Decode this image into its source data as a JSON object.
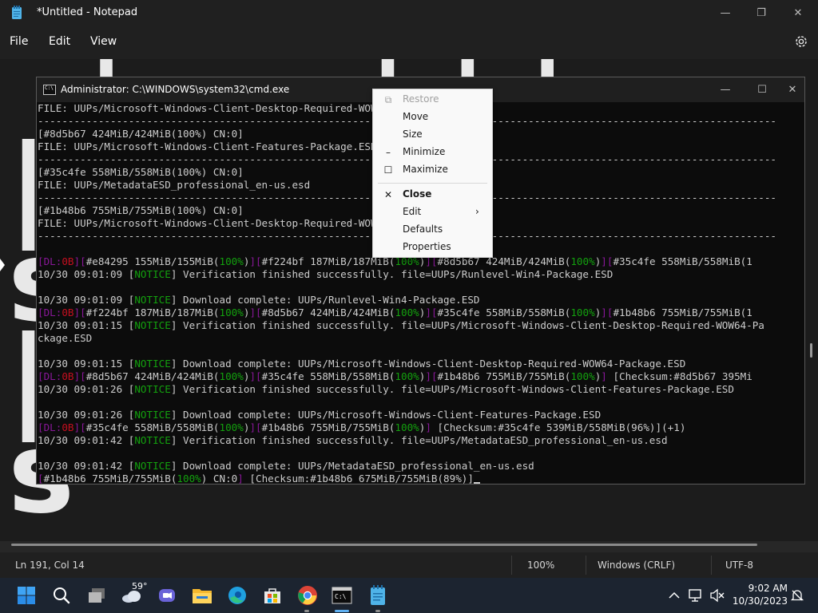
{
  "notepad": {
    "title": "*Untitled - Notepad",
    "menu": {
      "file": "File",
      "edit": "Edit",
      "view": "View"
    },
    "window_controls": {
      "minimize": "—",
      "maximize": "❐",
      "close": "✕"
    },
    "background_text": "  | ,  , | | |\n|\ns\n|\ns\nc",
    "status": {
      "position": "Ln 191, Col 14",
      "zoom": "100%",
      "line_ending": "Windows (CRLF)",
      "encoding": "UTF-8"
    }
  },
  "cmd": {
    "title": "Administrator: C:\\WINDOWS\\system32\\cmd.exe",
    "window_controls": {
      "minimize": "—",
      "maximize": "☐",
      "close": "✕"
    },
    "lines": [
      [
        {
          "t": "FILE: UUPs/Microsoft-Windows-Client-Desktop-Required-WOW64-Package.ESD"
        }
      ],
      [
        {
          "t": "--------------------------------------------------------------------------------------------------------------------------"
        }
      ],
      [
        {
          "t": "[#8d5b67 424MiB/424MiB(100%) CN:0]"
        }
      ],
      [
        {
          "t": "FILE: UUPs/Microsoft-Windows-Client-Features-Package.ESD"
        }
      ],
      [
        {
          "t": "--------------------------------------------------------------------------------------------------------------------------"
        }
      ],
      [
        {
          "t": "[#35c4fe 558MiB/558MiB(100%) CN:0]"
        }
      ],
      [
        {
          "t": "FILE: UUPs/MetadataESD_professional_en-us.esd"
        }
      ],
      [
        {
          "t": "--------------------------------------------------------------------------------------------------------------------------"
        }
      ],
      [
        {
          "t": "[#1b48b6 755MiB/755MiB(100%) CN:0]"
        }
      ],
      [
        {
          "t": "FILE: UUPs/Microsoft-Windows-Client-Desktop-Required-WOW64-Package.ESD"
        }
      ],
      [
        {
          "t": "--------------------------------------------------------------------------------------------------------------------------"
        }
      ],
      [
        {
          "t": ""
        }
      ],
      [
        {
          "t": "[",
          "c": "m"
        },
        {
          "t": "DL:",
          "c": "m"
        },
        {
          "t": "0B",
          "c": "r"
        },
        {
          "t": "][",
          "c": "m"
        },
        {
          "t": "#e84295 155MiB/155MiB("
        },
        {
          "t": "100%",
          "c": "g"
        },
        {
          "t": ")"
        },
        {
          "t": "][",
          "c": "m"
        },
        {
          "t": "#f224bf 187MiB/187MiB("
        },
        {
          "t": "100%",
          "c": "g"
        },
        {
          "t": ")"
        },
        {
          "t": "][",
          "c": "m"
        },
        {
          "t": "#8d5b67 424MiB/424MiB("
        },
        {
          "t": "100%",
          "c": "g"
        },
        {
          "t": ")"
        },
        {
          "t": "][",
          "c": "m"
        },
        {
          "t": "#35c4fe 558MiB/558MiB(1"
        }
      ],
      [
        {
          "t": "10/30 09:01:09 ["
        },
        {
          "t": "NOTICE",
          "c": "g"
        },
        {
          "t": "] Verification finished successfully. file=UUPs/Runlevel-Win4-Package.ESD"
        }
      ],
      [
        {
          "t": ""
        }
      ],
      [
        {
          "t": "10/30 09:01:09 ["
        },
        {
          "t": "NOTICE",
          "c": "g"
        },
        {
          "t": "] Download complete: UUPs/Runlevel-Win4-Package.ESD"
        }
      ],
      [
        {
          "t": "[",
          "c": "m"
        },
        {
          "t": "DL:",
          "c": "m"
        },
        {
          "t": "0B",
          "c": "r"
        },
        {
          "t": "][",
          "c": "m"
        },
        {
          "t": "#f224bf 187MiB/187MiB("
        },
        {
          "t": "100%",
          "c": "g"
        },
        {
          "t": ")"
        },
        {
          "t": "][",
          "c": "m"
        },
        {
          "t": "#8d5b67 424MiB/424MiB("
        },
        {
          "t": "100%",
          "c": "g"
        },
        {
          "t": ")"
        },
        {
          "t": "][",
          "c": "m"
        },
        {
          "t": "#35c4fe 558MiB/558MiB("
        },
        {
          "t": "100%",
          "c": "g"
        },
        {
          "t": ")"
        },
        {
          "t": "][",
          "c": "m"
        },
        {
          "t": "#1b48b6 755MiB/755MiB(1"
        }
      ],
      [
        {
          "t": "10/30 09:01:15 ["
        },
        {
          "t": "NOTICE",
          "c": "g"
        },
        {
          "t": "] Verification finished successfully. file=UUPs/Microsoft-Windows-Client-Desktop-Required-WOW64-Pa"
        }
      ],
      [
        {
          "t": "ckage.ESD"
        }
      ],
      [
        {
          "t": ""
        }
      ],
      [
        {
          "t": "10/30 09:01:15 ["
        },
        {
          "t": "NOTICE",
          "c": "g"
        },
        {
          "t": "] Download complete: UUPs/Microsoft-Windows-Client-Desktop-Required-WOW64-Package.ESD"
        }
      ],
      [
        {
          "t": "[",
          "c": "m"
        },
        {
          "t": "DL:",
          "c": "m"
        },
        {
          "t": "0B",
          "c": "r"
        },
        {
          "t": "][",
          "c": "m"
        },
        {
          "t": "#8d5b67 424MiB/424MiB("
        },
        {
          "t": "100%",
          "c": "g"
        },
        {
          "t": ")"
        },
        {
          "t": "][",
          "c": "m"
        },
        {
          "t": "#35c4fe 558MiB/558MiB("
        },
        {
          "t": "100%",
          "c": "g"
        },
        {
          "t": ")"
        },
        {
          "t": "][",
          "c": "m"
        },
        {
          "t": "#1b48b6 755MiB/755MiB("
        },
        {
          "t": "100%",
          "c": "g"
        },
        {
          "t": ")"
        },
        {
          "t": "]",
          "c": "m"
        },
        {
          "t": " [Checksum:#8d5b67 395Mi"
        }
      ],
      [
        {
          "t": "10/30 09:01:26 ["
        },
        {
          "t": "NOTICE",
          "c": "g"
        },
        {
          "t": "] Verification finished successfully. file=UUPs/Microsoft-Windows-Client-Features-Package.ESD"
        }
      ],
      [
        {
          "t": ""
        }
      ],
      [
        {
          "t": "10/30 09:01:26 ["
        },
        {
          "t": "NOTICE",
          "c": "g"
        },
        {
          "t": "] Download complete: UUPs/Microsoft-Windows-Client-Features-Package.ESD"
        }
      ],
      [
        {
          "t": "[",
          "c": "m"
        },
        {
          "t": "DL:",
          "c": "m"
        },
        {
          "t": "0B",
          "c": "r"
        },
        {
          "t": "][",
          "c": "m"
        },
        {
          "t": "#35c4fe 558MiB/558MiB("
        },
        {
          "t": "100%",
          "c": "g"
        },
        {
          "t": ")"
        },
        {
          "t": "][",
          "c": "m"
        },
        {
          "t": "#1b48b6 755MiB/755MiB("
        },
        {
          "t": "100%",
          "c": "g"
        },
        {
          "t": ")"
        },
        {
          "t": "]",
          "c": "m"
        },
        {
          "t": " [Checksum:#35c4fe 539MiB/558MiB(96%)](+1)"
        }
      ],
      [
        {
          "t": "10/30 09:01:42 ["
        },
        {
          "t": "NOTICE",
          "c": "g"
        },
        {
          "t": "] Verification finished successfully. file=UUPs/MetadataESD_professional_en-us.esd"
        }
      ],
      [
        {
          "t": ""
        }
      ],
      [
        {
          "t": "10/30 09:01:42 ["
        },
        {
          "t": "NOTICE",
          "c": "g"
        },
        {
          "t": "] Download complete: UUPs/MetadataESD_professional_en-us.esd"
        }
      ],
      [
        {
          "t": "[",
          "c": "m"
        },
        {
          "t": "#1b48b6 755MiB/755MiB("
        },
        {
          "t": "100%",
          "c": "g"
        },
        {
          "t": ") CN:0"
        },
        {
          "t": "]",
          "c": "m"
        },
        {
          "t": " [Checksum:#1b48b6 675MiB/755MiB(89%)]"
        }
      ]
    ]
  },
  "context_menu": {
    "items": [
      {
        "label": "Restore",
        "icon": "restore-icon",
        "glyph": "⧉",
        "disabled": true,
        "bold": false
      },
      {
        "label": "Move",
        "icon": "",
        "glyph": "",
        "disabled": false,
        "bold": false
      },
      {
        "label": "Size",
        "icon": "",
        "glyph": "",
        "disabled": false,
        "bold": false
      },
      {
        "label": "Minimize",
        "icon": "minimize-icon",
        "glyph": "–",
        "disabled": false,
        "bold": false
      },
      {
        "label": "Maximize",
        "icon": "maximize-icon",
        "glyph": "☐",
        "disabled": false,
        "bold": false
      },
      {
        "label": "Close",
        "icon": "close-icon",
        "glyph": "✕",
        "disabled": false,
        "bold": true
      },
      {
        "label": "Edit",
        "icon": "",
        "glyph": "",
        "disabled": false,
        "bold": false,
        "submenu": true
      },
      {
        "label": "Defaults",
        "icon": "",
        "glyph": "",
        "disabled": false,
        "bold": false
      },
      {
        "label": "Properties",
        "icon": "",
        "glyph": "",
        "disabled": false,
        "bold": false
      }
    ]
  },
  "taskbar": {
    "weather_temp": "59°",
    "time": "9:02 AM",
    "date": "10/30/2023"
  },
  "colors": {
    "cmd_green": "#13a10e",
    "cmd_magenta": "#881798",
    "cmd_red": "#c50f1f",
    "windows_blue": "#2f8cf0"
  }
}
